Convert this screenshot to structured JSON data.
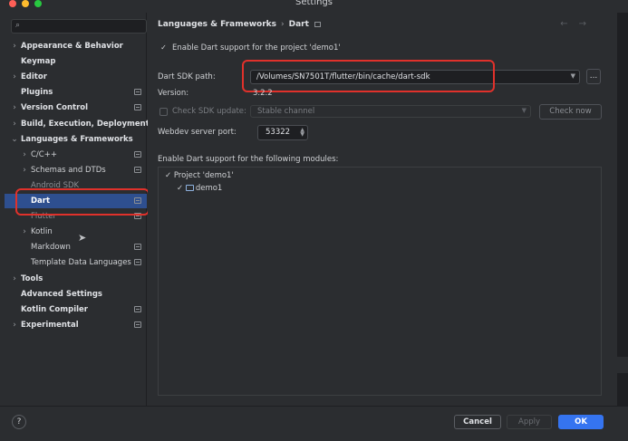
{
  "window": {
    "title": "Settings"
  },
  "sidebar": {
    "items": [
      {
        "label": "Appearance & Behavior",
        "chevron": "›",
        "level": 0,
        "bold": true,
        "badge": false
      },
      {
        "label": "Keymap",
        "chevron": "",
        "level": 0,
        "bold": true,
        "badge": false
      },
      {
        "label": "Editor",
        "chevron": "›",
        "level": 0,
        "bold": true,
        "badge": false
      },
      {
        "label": "Plugins",
        "chevron": "",
        "level": 0,
        "bold": true,
        "badge": true
      },
      {
        "label": "Version Control",
        "chevron": "›",
        "level": 0,
        "bold": true,
        "badge": true
      },
      {
        "label": "Build, Execution, Deployment",
        "chevron": "›",
        "level": 0,
        "bold": true,
        "badge": false
      },
      {
        "label": "Languages & Frameworks",
        "chevron": "⌄",
        "level": 0,
        "bold": true,
        "badge": false
      },
      {
        "label": "C/C++",
        "chevron": "›",
        "level": 1,
        "bold": false,
        "badge": true
      },
      {
        "label": "Schemas and DTDs",
        "chevron": "›",
        "level": 1,
        "bold": false,
        "badge": true
      },
      {
        "label": "Android SDK",
        "chevron": "",
        "level": 1,
        "bold": false,
        "badge": false
      },
      {
        "label": "Dart",
        "chevron": "",
        "level": 1,
        "bold": false,
        "badge": true,
        "selected": true
      },
      {
        "label": "Flutter",
        "chevron": "",
        "level": 1,
        "bold": false,
        "badge": true
      },
      {
        "label": "Kotlin",
        "chevron": "›",
        "level": 1,
        "bold": false,
        "badge": false
      },
      {
        "label": "Markdown",
        "chevron": "",
        "level": 1,
        "bold": false,
        "badge": true
      },
      {
        "label": "Template Data Languages",
        "chevron": "",
        "level": 1,
        "bold": false,
        "badge": true
      },
      {
        "label": "Tools",
        "chevron": "›",
        "level": 0,
        "bold": true,
        "badge": false
      },
      {
        "label": "Advanced Settings",
        "chevron": "",
        "level": 0,
        "bold": true,
        "badge": false
      },
      {
        "label": "Kotlin Compiler",
        "chevron": "",
        "level": 0,
        "bold": true,
        "badge": true
      },
      {
        "label": "Experimental",
        "chevron": "›",
        "level": 0,
        "bold": true,
        "badge": true
      }
    ]
  },
  "main": {
    "breadcrumb": {
      "parent": "Languages & Frameworks",
      "separator": "›",
      "current": "Dart"
    },
    "nav": {
      "back": "←",
      "forward": "→"
    },
    "enable_dart": {
      "label": "Enable Dart support for the project 'demo1'",
      "checked": true
    },
    "sdk_path": {
      "label": "Dart SDK path:",
      "value": "/Volumes/SN7501T/flutter/bin/cache/dart-sdk",
      "browse_label": "..."
    },
    "version": {
      "label": "Version:",
      "value": "3.2.2"
    },
    "sdk_update": {
      "label": "Check SDK update:",
      "checked": false,
      "channel": "Stable channel",
      "check_now_label": "Check now"
    },
    "webdev": {
      "label": "Webdev server port:",
      "value": "53322"
    },
    "modules": {
      "label": "Enable Dart support for the following modules:",
      "project": "Project 'demo1'",
      "module": "demo1"
    }
  },
  "footer": {
    "help_label": "?",
    "cancel_label": "Cancel",
    "apply_label": "Apply",
    "ok_label": "OK"
  },
  "colors": {
    "background": "#2b2d30",
    "selection": "#2e4f8f",
    "accent": "#3574f0",
    "highlight_annotation": "#e0312b"
  }
}
